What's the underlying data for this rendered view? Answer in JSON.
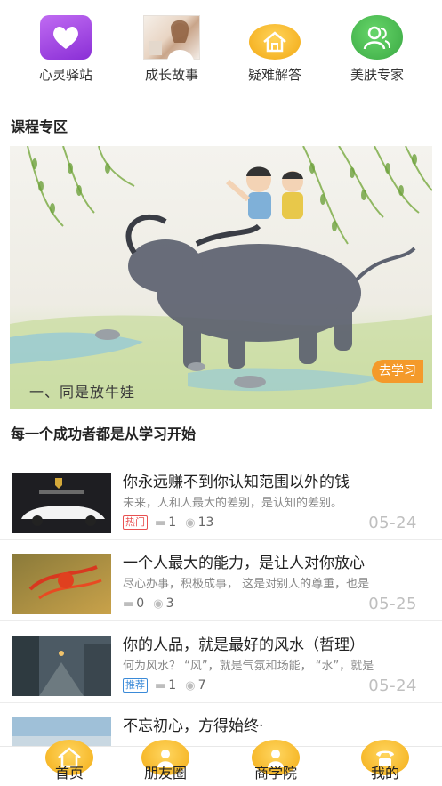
{
  "quick_nav": [
    {
      "label": "心灵驿站",
      "icon": "heart-icon"
    },
    {
      "label": "成长故事",
      "icon": "photo-thumbnail"
    },
    {
      "label": "疑难解答",
      "icon": "house-icon"
    },
    {
      "label": "美肤专家",
      "icon": "people-icon"
    }
  ],
  "course_section": {
    "title": "课程专区",
    "banner_caption": "一、同是放牛娃",
    "banner_button": "去学习"
  },
  "list_section": {
    "title": "每一个成功者都是从学习开始"
  },
  "articles": [
    {
      "title": "你永远赚不到你认知范围以外的钱",
      "subtitle": "未来，人和人最大的差别，是认知的差别。",
      "tag": "热门",
      "tag_type": "hot",
      "comments": "1",
      "views": "13",
      "date": "05-24",
      "thumb": "car-thumbnail"
    },
    {
      "title": "一个人最大的能力，是让人对你放心",
      "subtitle": "尽心办事，积极成事， 这是对别人的尊重，也是",
      "tag": "",
      "tag_type": "",
      "comments": "0",
      "views": "3",
      "date": "05-25",
      "thumb": "leaves-thumbnail"
    },
    {
      "title": "你的人品，就是最好的风水（哲理）",
      "subtitle": "何为风水？ “风”，就是气氛和场能， “水”，就是",
      "tag": "推荐",
      "tag_type": "rec",
      "comments": "1",
      "views": "7",
      "date": "05-24",
      "thumb": "street-thumbnail"
    },
    {
      "title": "不忘初心，方得始终·",
      "subtitle": "",
      "tag": "",
      "tag_type": "",
      "comments": "",
      "views": "",
      "date": "",
      "thumb": "sky-thumbnail"
    }
  ],
  "tabbar": [
    {
      "label": "首页",
      "icon": "home-icon"
    },
    {
      "label": "朋友圈",
      "icon": "friends-icon"
    },
    {
      "label": "商学院",
      "icon": "academy-icon"
    },
    {
      "label": "我的",
      "icon": "phone-icon"
    }
  ],
  "colors": {
    "accent": "#f49a2b",
    "hot": "#e85050",
    "rec": "#3a8ad8"
  }
}
